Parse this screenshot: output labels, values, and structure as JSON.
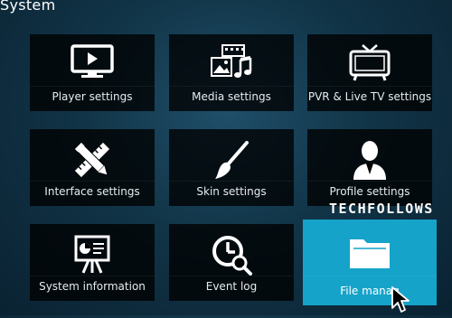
{
  "window": {
    "title": "System"
  },
  "tiles": [
    {
      "label": "Player settings",
      "icon": "monitor-play-icon"
    },
    {
      "label": "Media settings",
      "icon": "media-icon"
    },
    {
      "label": "PVR & Live TV settings",
      "icon": "tv-icon"
    },
    {
      "label": "Interface settings",
      "icon": "pencil-ruler-icon"
    },
    {
      "label": "Skin settings",
      "icon": "paintbrush-icon"
    },
    {
      "label": "Profile settings",
      "icon": "user-icon"
    },
    {
      "label": "System information",
      "icon": "presentation-icon"
    },
    {
      "label": "Event log",
      "icon": "clock-search-icon"
    },
    {
      "label": "File manag",
      "icon": "folder-icon",
      "selected": true
    }
  ],
  "watermark": {
    "text": "TECHFOLLOWS"
  },
  "colors": {
    "tile_bg": "#000000",
    "selected_tile": "#16a3c9",
    "background": "#113447"
  }
}
